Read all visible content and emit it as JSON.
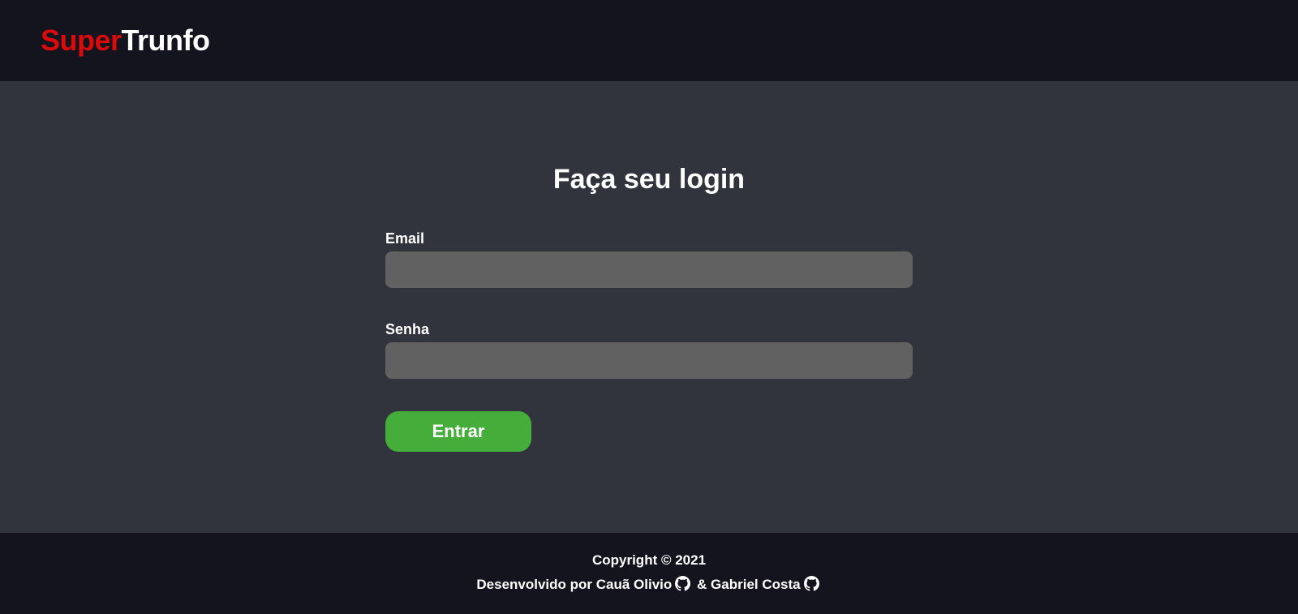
{
  "header": {
    "logo_part1": "Super",
    "logo_part2": "Trunfo"
  },
  "login": {
    "title": "Faça seu login",
    "email_label": "Email",
    "email_value": "",
    "senha_label": "Senha",
    "senha_value": "",
    "submit_label": "Entrar"
  },
  "footer": {
    "copyright": "Copyright © 2021",
    "developed_by": "Desenvolvido por",
    "author1": "Cauã Olivio",
    "separator": "&",
    "author2": "Gabriel Costa",
    "icon": "github-icon"
  },
  "colors": {
    "header_bg": "#13141d",
    "main_bg": "#31343d",
    "logo_red": "#dc0a0a",
    "input_bg": "#616161",
    "button_green": "#45ad39"
  }
}
